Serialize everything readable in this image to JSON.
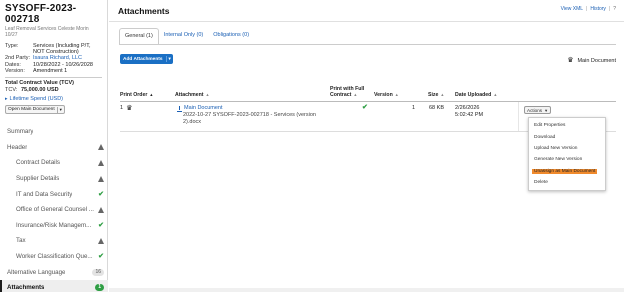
{
  "sidebar": {
    "contract_id": "SYSOFF-2023-002718",
    "contract_subtitle": "Leaf Removal Services Celeste Morin 10/27",
    "meta": [
      {
        "key": "Type:",
        "value": "Services (Including P/T, NOT Construction)"
      },
      {
        "key": "2nd Party:",
        "value": "Isaura Richard, LLC"
      },
      {
        "key": "Dates:",
        "value": "10/28/2022 - 10/26/2028"
      },
      {
        "key": "Version:",
        "value": "Amendment 1"
      }
    ],
    "tcv_label": "Total Contract Value (TCV)",
    "tcv_key": "TCV:",
    "tcv_value": "75,000.00",
    "tcv_currency": "USD",
    "lifetime_spend": "Lifetime Spend (USD)",
    "open_main_document": "Open Main Document",
    "nav": [
      {
        "label": "Summary",
        "status": "",
        "level": "top"
      },
      {
        "label": "Header",
        "status": "warning",
        "level": "top"
      },
      {
        "label": "Contract Details",
        "status": "warning",
        "level": "sub"
      },
      {
        "label": "Supplier Details",
        "status": "warning",
        "level": "sub"
      },
      {
        "label": "IT and Data Security",
        "status": "check",
        "level": "sub"
      },
      {
        "label": "Office of General Counsel ...",
        "status": "warning",
        "level": "sub"
      },
      {
        "label": "Insurance/Risk Managem...",
        "status": "check",
        "level": "sub"
      },
      {
        "label": "Tax",
        "status": "warning",
        "level": "sub"
      },
      {
        "label": "Worker Classification Que...",
        "status": "check",
        "level": "sub"
      },
      {
        "label": "Alternative Language",
        "status": "badge",
        "badge": "16",
        "level": "top"
      },
      {
        "label": "Attachments",
        "status": "badge-green",
        "badge": "1",
        "level": "top",
        "active": true
      }
    ]
  },
  "header": {
    "title": "Attachments",
    "links": {
      "view_xml": "View XML",
      "history": "History",
      "help": "?"
    }
  },
  "tabs": [
    {
      "label": "General (1)",
      "active": true
    },
    {
      "label": "Internal Only (0)",
      "active": false
    },
    {
      "label": "Obligations (0)",
      "active": false
    }
  ],
  "toolbar": {
    "add_attachments": "Add Attachments",
    "main_document_legend": "Main Document"
  },
  "grid": {
    "columns": {
      "print_order": "Print Order",
      "attachment": "Attachment",
      "print_full_contract": "Print with Full Contract",
      "version": "Version",
      "size": "Size",
      "date_uploaded": "Date Uploaded"
    },
    "rows": [
      {
        "print_order": "1",
        "is_main": true,
        "link_text": "Main Document",
        "file_name": "2022-10-27 SYSOFF-2023-002718 - Services (version 2).docx",
        "print_full_contract": true,
        "version": "1",
        "size": "68 KB",
        "date": "2/26/2026",
        "time": "5:02:42 PM",
        "actions_label": "Actions"
      }
    ]
  },
  "actions_menu": {
    "items": [
      {
        "label": "Edit Properties",
        "highlighted": false
      },
      {
        "label": "Download",
        "highlighted": false
      },
      {
        "label": "Upload New Version",
        "highlighted": false
      },
      {
        "label": "Generate New Version",
        "highlighted": false
      },
      {
        "label": "Unassign as Main Document",
        "highlighted": true
      },
      {
        "label": "Delete",
        "highlighted": false
      }
    ]
  },
  "colors": {
    "accent": "#1a6fc4",
    "link": "#1a5fb4",
    "success": "#2f9e44",
    "highlight": "#f08a2c"
  }
}
